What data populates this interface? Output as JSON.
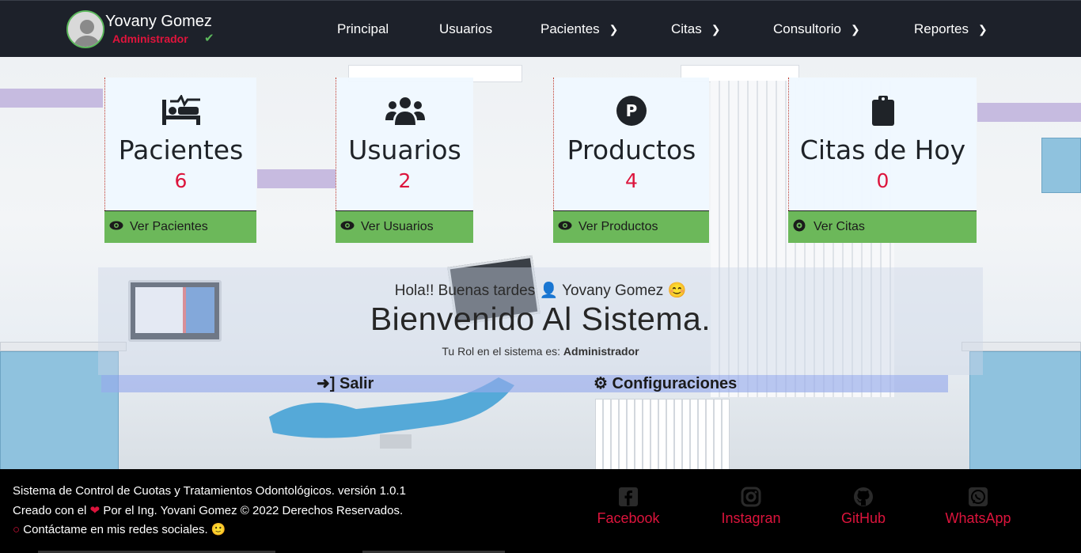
{
  "header": {
    "user_name": "Yovany Gomez",
    "user_role": "Administrador",
    "nav": [
      {
        "label": "Principal",
        "has_submenu": false
      },
      {
        "label": "Usuarios",
        "has_submenu": false
      },
      {
        "label": "Pacientes",
        "has_submenu": true
      },
      {
        "label": "Citas",
        "has_submenu": true
      },
      {
        "label": "Consultorio",
        "has_submenu": true
      },
      {
        "label": "Reportes",
        "has_submenu": true
      }
    ]
  },
  "cards": [
    {
      "title": "Pacientes",
      "count": "6",
      "link": "Ver Pacientes",
      "icon": "procedures-icon"
    },
    {
      "title": "Usuarios",
      "count": "2",
      "link": "Ver Usuarios",
      "icon": "users-icon"
    },
    {
      "title": "Productos",
      "count": "4",
      "link": "Ver Productos",
      "icon": "product-p-icon"
    },
    {
      "title": "Citas de Hoy",
      "count": "0",
      "link": "Ver Citas",
      "icon": "clipboard-icon"
    }
  ],
  "welcome": {
    "greeting_prefix": "Hola!! Buenas tardes",
    "greeting_name": "Yovany Gomez",
    "title": "Bienvenido Al Sistema.",
    "role_prefix": "Tu Rol en el sistema es:",
    "role_value": "Administrador",
    "logout_label": "Salir",
    "settings_label": "Configuraciones"
  },
  "footer": {
    "line1": "Sistema de Control de Cuotas y Tratamientos Odontológicos. versión 1.0.1",
    "line2_a": "Creado con el",
    "line2_b": "Por el Ing. Yovani Gomez",
    "line2_c": "2022 Derechos Reservados.",
    "line3": "Contáctame en mis redes sociales.",
    "socials": [
      {
        "label": "Facebook",
        "icon": "facebook-icon"
      },
      {
        "label": "Instagran",
        "icon": "instagram-icon"
      },
      {
        "label": "GitHub",
        "icon": "github-icon"
      },
      {
        "label": "WhatsApp",
        "icon": "whatsapp-icon"
      }
    ]
  },
  "colors": {
    "header_bg": "#1d212a",
    "accent_red": "#dc143c",
    "card_link_green": "#6cb85a",
    "footer_bg": "#000000"
  }
}
